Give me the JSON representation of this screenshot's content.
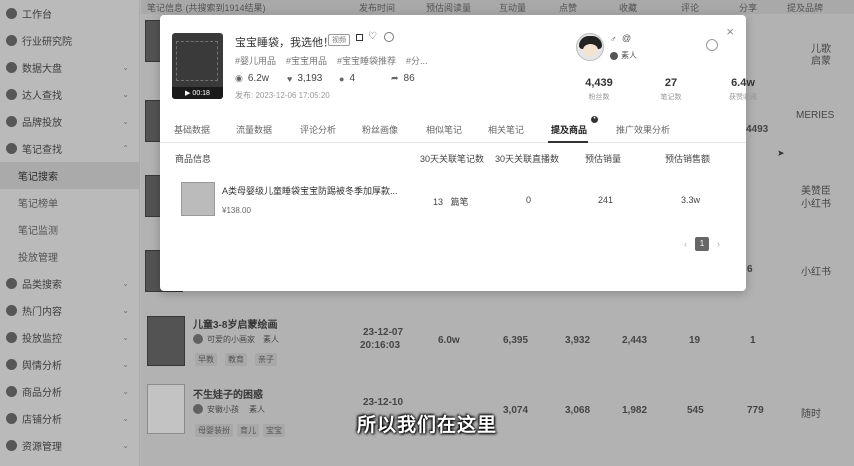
{
  "sidebar": {
    "items": [
      {
        "label": "工作台",
        "caret": ""
      },
      {
        "label": "行业研究院",
        "caret": ""
      },
      {
        "label": "数据大盘",
        "caret": "⌄"
      },
      {
        "label": "达人查找",
        "caret": "⌄"
      },
      {
        "label": "品牌投放",
        "caret": "⌄"
      },
      {
        "label": "笔记查找",
        "caret": "⌃"
      }
    ],
    "subitems": [
      "笔记搜索",
      "笔记榜单",
      "笔记监测",
      "投放管理"
    ],
    "items2": [
      {
        "label": "品类搜索",
        "caret": "⌄"
      },
      {
        "label": "热门内容",
        "caret": "⌄"
      },
      {
        "label": "投放监控",
        "caret": "⌄"
      },
      {
        "label": "舆情分析",
        "caret": "⌄"
      },
      {
        "label": "商品分析",
        "caret": "⌄"
      },
      {
        "label": "店铺分析",
        "caret": "⌄"
      },
      {
        "label": "资源管理",
        "caret": "⌄"
      }
    ]
  },
  "background": {
    "header": [
      "笔记信息 (共搜索到1914结果)",
      "发布时间",
      "预估阅读量",
      "互动量",
      "点赞",
      "收藏",
      "评论",
      "分享",
      "提及品牌"
    ],
    "rows": [
      {
        "title": "儿童3-8岁启蒙绘画",
        "author": "可爱的小画家",
        "role": "素人",
        "date": "23-12-07",
        "time": "20:16:03",
        "reads": "6.0w",
        "inter": "6,395",
        "likes": "3,932",
        "coll": "2,443",
        "comm": "19",
        "share": "1",
        "tags": [
          "早教",
          "教育",
          "亲子"
        ]
      },
      {
        "title": "不生娃子的困惑",
        "author": "安徽小孩",
        "role": "素人",
        "date": "23-12-10",
        "time": "",
        "reads": "",
        "inter": "3,074",
        "likes": "3,068",
        "coll": "1,982",
        "comm": "545",
        "share": "779",
        "brand": "随时",
        "tags": [
          "母婴装扮",
          "育儿",
          "宝宝"
        ]
      }
    ],
    "right_col": [
      "儿歌",
      "启蒙",
      "MERIES",
      "4493",
      "美赞臣",
      "小红书",
      "小红书",
      "6"
    ]
  },
  "modal": {
    "close": "×",
    "cover_duration": "00:18",
    "title": "宝宝睡袋，我选他！",
    "title_badge": "视频",
    "tags": [
      "#婴儿用品",
      "#宝宝用品",
      "#宝宝睡袋推荐",
      "#分..."
    ],
    "stats": [
      {
        "icon": "eye-icon",
        "glyph": "◉",
        "value": "6.2w"
      },
      {
        "icon": "heart-icon",
        "glyph": "♥",
        "value": "3,193"
      },
      {
        "icon": "comment-icon",
        "glyph": "●",
        "value": "4"
      },
      {
        "icon": "share-icon",
        "glyph": "➦",
        "value": "86"
      }
    ],
    "publish_time": "发布: 2023-12-06 17:05:20",
    "author": {
      "gender": "♂",
      "at": "@",
      "role": "素人",
      "stats": [
        {
          "value": "4,439",
          "label": "粉丝数"
        },
        {
          "value": "27",
          "label": "笔记数"
        },
        {
          "value": "6.4w",
          "label": "获赞收藏"
        }
      ]
    },
    "tabs": [
      "基础数据",
      "流量数据",
      "评论分析",
      "粉丝画像",
      "相似笔记",
      "相关笔记",
      "提及商品",
      "推广效果分析"
    ],
    "active_tab": "提及商品",
    "table": {
      "headers": [
        "商品信息",
        "30天关联笔记数",
        "30天关联直播数",
        "预估销量",
        "预估销售额"
      ],
      "rows": [
        {
          "name": "A类母婴级儿童睡袋宝宝防踢被冬季加厚款...",
          "price": "¥138.00",
          "notes": "13",
          "notes_suffix": "篇笔",
          "lives": "0",
          "sales": "241",
          "revenue": "3.3w"
        }
      ]
    },
    "pager": {
      "prev": "‹",
      "page": "1",
      "next": "›"
    }
  },
  "subtitle": "所以我们在这里"
}
